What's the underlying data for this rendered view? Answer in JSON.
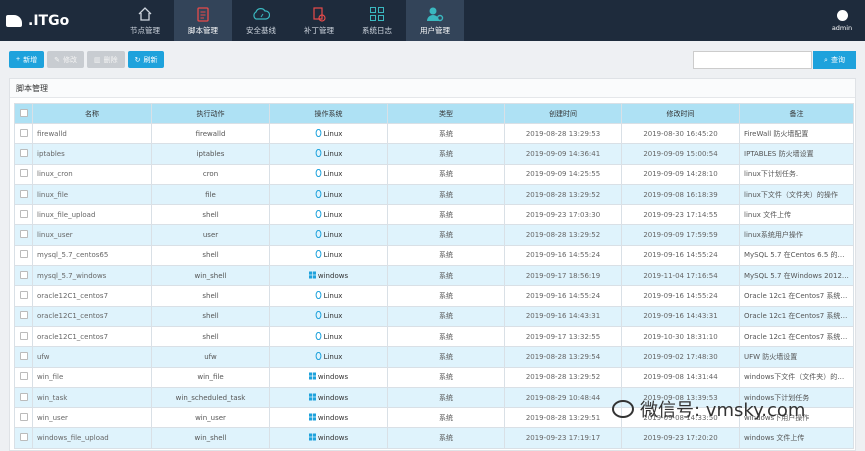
{
  "app": {
    "logo_text": ".ITGo",
    "user_label": "admin"
  },
  "nav": [
    {
      "label": "节点管理",
      "icon": "home-icon"
    },
    {
      "label": "脚本管理",
      "icon": "clipboard-icon"
    },
    {
      "label": "安全基线",
      "icon": "cloud-gauge-icon"
    },
    {
      "label": "补丁管理",
      "icon": "patch-icon"
    },
    {
      "label": "系统日志",
      "icon": "grid-icon"
    },
    {
      "label": "用户管理",
      "icon": "user-gear-icon"
    }
  ],
  "toolbar": {
    "add": "新增",
    "edit": "修改",
    "delete": "删除",
    "refresh": "刷新"
  },
  "search": {
    "placeholder": "",
    "button": "查询"
  },
  "panel": {
    "title": "脚本管理"
  },
  "table": {
    "headers": [
      "名称",
      "执行动作",
      "操作系统",
      "类型",
      "创建时间",
      "修改时间",
      "备注"
    ],
    "rows": [
      {
        "name": "firewalld",
        "action": "firewalld",
        "os": "Linux",
        "type": "系统",
        "created": "2019-08-28 13:29:53",
        "modified": "2019-08-30 16:45:20",
        "note": "FireWall 防火墙配置"
      },
      {
        "name": "iptables",
        "action": "iptables",
        "os": "Linux",
        "type": "系统",
        "created": "2019-09-09 14:36:41",
        "modified": "2019-09-09 15:00:54",
        "note": "IPTABLES 防火墙设置"
      },
      {
        "name": "linux_cron",
        "action": "cron",
        "os": "Linux",
        "type": "系统",
        "created": "2019-09-09 14:25:55",
        "modified": "2019-09-09 14:28:10",
        "note": "linux下计划任务."
      },
      {
        "name": "linux_file",
        "action": "file",
        "os": "Linux",
        "type": "系统",
        "created": "2019-08-28 13:29:52",
        "modified": "2019-09-08 16:18:39",
        "note": "linux下文件（文件夹）的操作"
      },
      {
        "name": "linux_file_upload",
        "action": "shell",
        "os": "Linux",
        "type": "系统",
        "created": "2019-09-23 17:03:30",
        "modified": "2019-09-23 17:14:55",
        "note": "linux 文件上传"
      },
      {
        "name": "linux_user",
        "action": "user",
        "os": "Linux",
        "type": "系统",
        "created": "2019-08-28 13:29:52",
        "modified": "2019-09-09 17:59:59",
        "note": "linux系统用户操作"
      },
      {
        "name": "mysql_5.7_centos65",
        "action": "shell",
        "os": "Linux",
        "type": "系统",
        "created": "2019-09-16 14:55:24",
        "modified": "2019-09-16 14:55:24",
        "note": "MySQL 5.7 在Centos 6.5 的安..."
      },
      {
        "name": "mysql_5.7_windows",
        "action": "win_shell",
        "os": "windows",
        "type": "系统",
        "created": "2019-09-17 18:56:19",
        "modified": "2019-11-04 17:16:54",
        "note": "MySQL 5.7 在Windows 2012/..."
      },
      {
        "name": "oracle12C1_centos7",
        "action": "shell",
        "os": "Linux",
        "type": "系统",
        "created": "2019-09-16 14:55:24",
        "modified": "2019-09-16 14:55:24",
        "note": "Oracle 12c1 在Centos7 系统上..."
      },
      {
        "name": "oracle12C1_centos7",
        "action": "shell",
        "os": "Linux",
        "type": "系统",
        "created": "2019-09-16 14:43:31",
        "modified": "2019-09-16 14:43:31",
        "note": "Oracle 12c1 在Centos7 系统上..."
      },
      {
        "name": "oracle12C1_centos7",
        "action": "shell",
        "os": "Linux",
        "type": "系统",
        "created": "2019-09-17 13:32:55",
        "modified": "2019-10-30 18:31:10",
        "note": "Oracle 12c1 在Centos7 系统上..."
      },
      {
        "name": "ufw",
        "action": "ufw",
        "os": "Linux",
        "type": "系统",
        "created": "2019-08-28 13:29:54",
        "modified": "2019-09-02 17:48:30",
        "note": "UFW 防火墙设置"
      },
      {
        "name": "win_file",
        "action": "win_file",
        "os": "windows",
        "type": "系统",
        "created": "2019-08-28 13:29:52",
        "modified": "2019-09-08 14:31:44",
        "note": "windows下文件（文件夹）的操..."
      },
      {
        "name": "win_task",
        "action": "win_scheduled_task",
        "os": "windows",
        "type": "系统",
        "created": "2019-08-29 10:48:44",
        "modified": "2019-09-08 13:39:53",
        "note": "windows下计划任务"
      },
      {
        "name": "win_user",
        "action": "win_user",
        "os": "windows",
        "type": "系统",
        "created": "2019-08-28 13:29:51",
        "modified": "2019-09-08 14:33:50",
        "note": "windows下用户操作"
      },
      {
        "name": "windows_file_upload",
        "action": "win_shell",
        "os": "windows",
        "type": "系统",
        "created": "2019-09-23 17:19:17",
        "modified": "2019-09-23 17:20:20",
        "note": "windows 文件上传"
      }
    ]
  },
  "watermark": {
    "text": "微信号: vmsky.com"
  },
  "colors": {
    "nav_bg": "#1e2b3c",
    "accent": "#1ea2dc",
    "row_alt": "#dff3fc",
    "header_bg": "#aee1f4"
  }
}
